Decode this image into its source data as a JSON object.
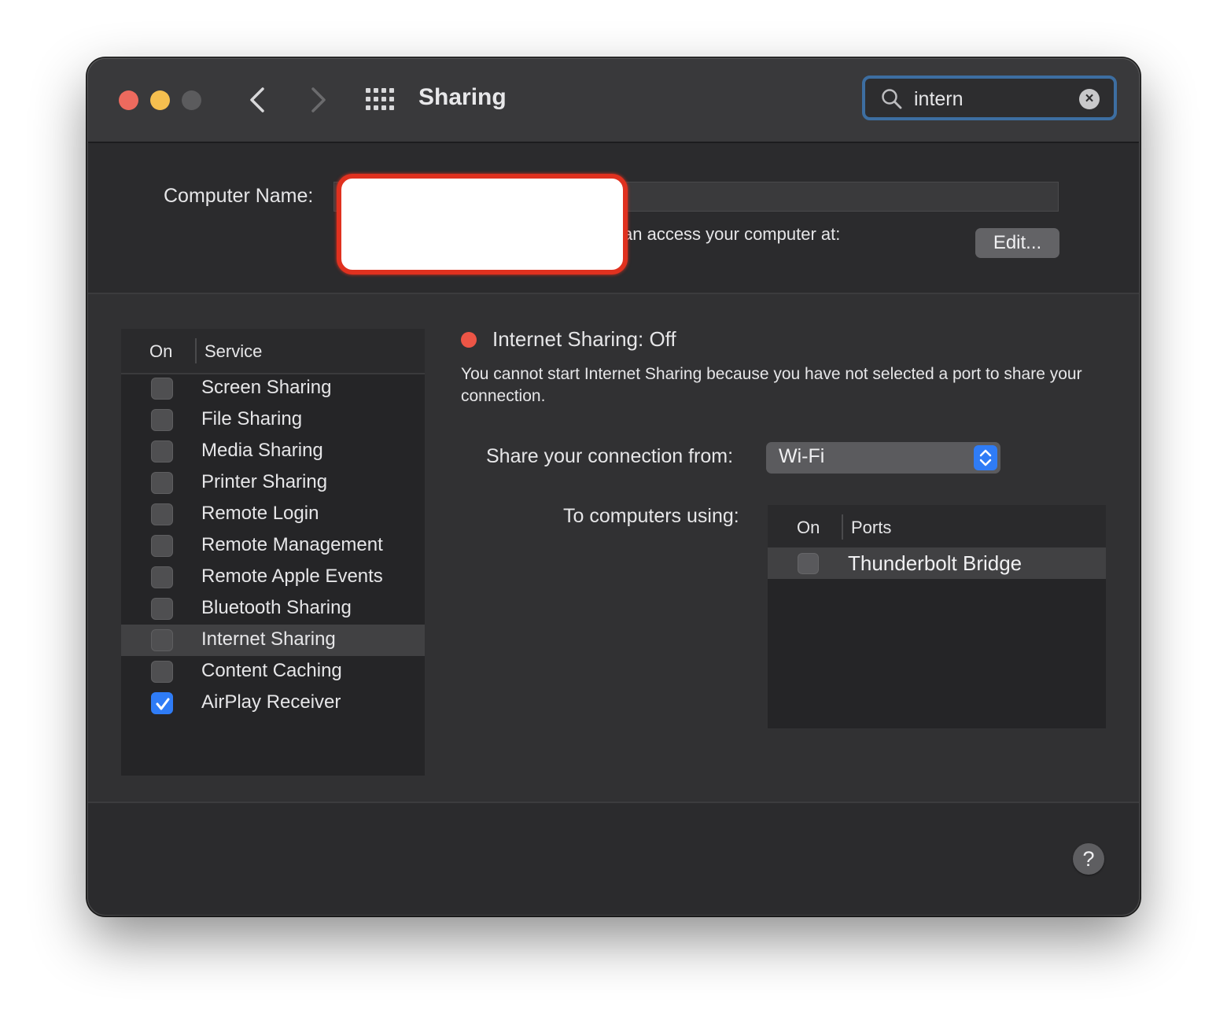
{
  "window": {
    "title": "Sharing"
  },
  "search": {
    "value": "intern",
    "clear_label": "×"
  },
  "computer_name": {
    "label": "Computer Name:",
    "access_text": "an access your computer at:",
    "edit_label": "Edit..."
  },
  "services": {
    "header_on": "On",
    "header_service": "Service",
    "items": [
      {
        "label": "Screen Sharing",
        "checked": false
      },
      {
        "label": "File Sharing",
        "checked": false
      },
      {
        "label": "Media Sharing",
        "checked": false
      },
      {
        "label": "Printer Sharing",
        "checked": false
      },
      {
        "label": "Remote Login",
        "checked": false
      },
      {
        "label": "Remote Management",
        "checked": false
      },
      {
        "label": "Remote Apple Events",
        "checked": false
      },
      {
        "label": "Bluetooth Sharing",
        "checked": false
      },
      {
        "label": "Internet Sharing",
        "checked": false,
        "selected": true
      },
      {
        "label": "Content Caching",
        "checked": false
      },
      {
        "label": "AirPlay Receiver",
        "checked": true
      }
    ]
  },
  "detail": {
    "status": "Internet Sharing: Off",
    "status_color": "#ec5546",
    "description": "You cannot start Internet Sharing because you have not selected a port to share your connection.",
    "from_label": "Share your connection from:",
    "from_value": "Wi-Fi",
    "to_label": "To computers using:",
    "ports_header_on": "On",
    "ports_header_ports": "Ports",
    "ports": [
      {
        "label": "Thunderbolt Bridge",
        "checked": false
      }
    ]
  },
  "help": {
    "label": "?"
  },
  "colors": {
    "accent": "#2f7cf6",
    "search_focus": "#3d6ea1",
    "redaction": "#e0311f"
  }
}
